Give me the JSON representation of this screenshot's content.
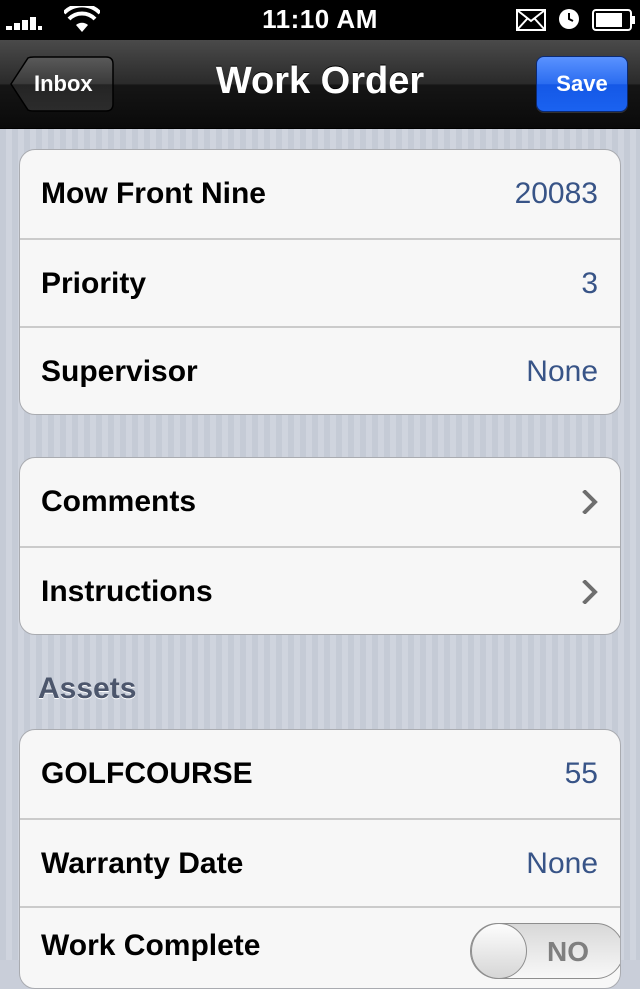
{
  "status_bar": {
    "time": "11:10 AM",
    "icons": [
      "signal-icon",
      "wifi-icon",
      "mail-icon",
      "alarm-icon",
      "battery-icon"
    ]
  },
  "nav": {
    "back_label": "Inbox",
    "title": "Work Order",
    "save_label": "Save"
  },
  "group1": [
    {
      "label": "Mow Front Nine",
      "value": "20083"
    },
    {
      "label": "Priority",
      "value": "3"
    },
    {
      "label": "Supervisor",
      "value": "None"
    }
  ],
  "group2": [
    {
      "label": "Comments",
      "icon": "chevron-right-icon"
    },
    {
      "label": "Instructions",
      "icon": "chevron-right-icon"
    }
  ],
  "assets": {
    "header": "Assets",
    "rows": [
      {
        "label": "GOLFCOURSE",
        "value": "55"
      },
      {
        "label": "Warranty Date",
        "value": "None"
      },
      {
        "label": "Work Complete",
        "toggle": "NO"
      }
    ]
  },
  "colors": {
    "value_text": "#385487",
    "save_button": "#1a62f0",
    "navbar": "#151515"
  }
}
